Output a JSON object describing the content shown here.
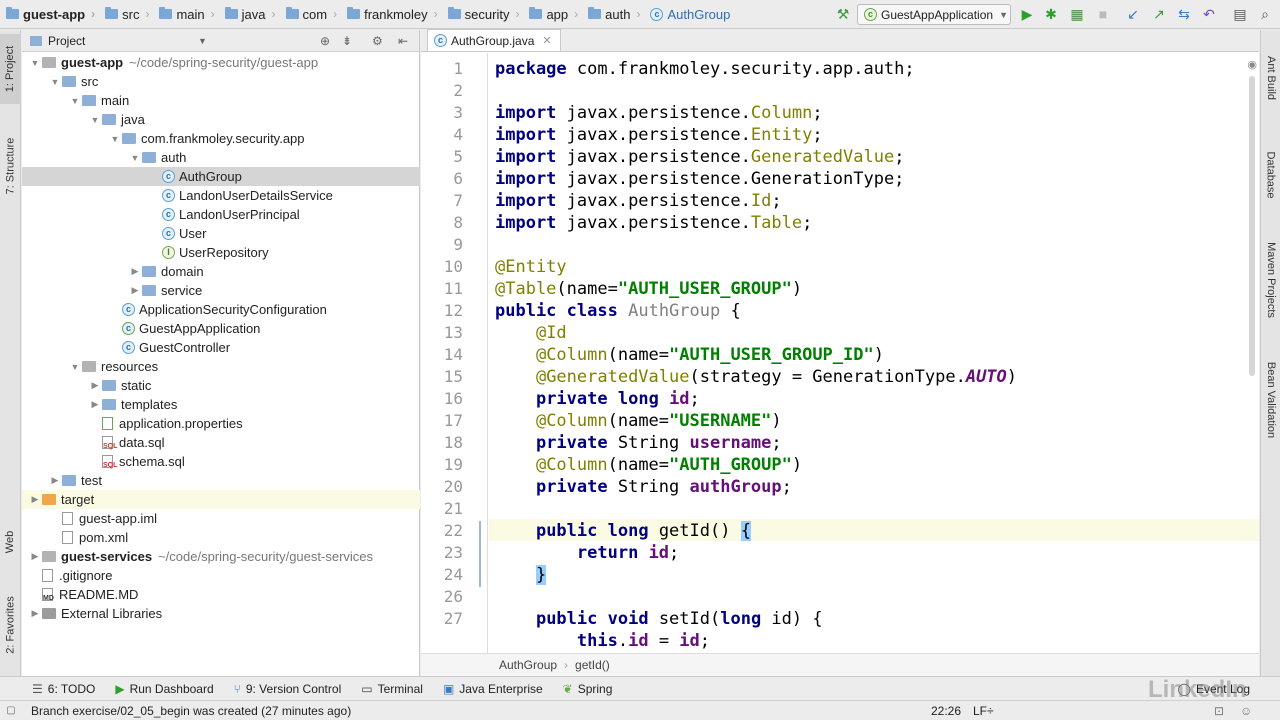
{
  "breadcrumbs": [
    "guest-app",
    "src",
    "main",
    "java",
    "com",
    "frankmoley",
    "security",
    "app",
    "auth",
    "AuthGroup"
  ],
  "run_config": "GuestAppApplication",
  "left_tabs": [
    "1: Project",
    "7: Structure",
    "Web",
    "2: Favorites"
  ],
  "right_tabs": [
    "Ant Build",
    "Database",
    "Maven Projects",
    "Bean Validation"
  ],
  "project": {
    "title": "Project",
    "rows": [
      {
        "label": "guest-app",
        "path": "~/code/spring-security/guest-app"
      },
      {
        "label": "src"
      },
      {
        "label": "main"
      },
      {
        "label": "java"
      },
      {
        "label": "com.frankmoley.security.app"
      },
      {
        "label": "auth"
      },
      {
        "label": "AuthGroup"
      },
      {
        "label": "LandonUserDetailsService"
      },
      {
        "label": "LandonUserPrincipal"
      },
      {
        "label": "User"
      },
      {
        "label": "UserRepository"
      },
      {
        "label": "domain"
      },
      {
        "label": "service"
      },
      {
        "label": "ApplicationSecurityConfiguration"
      },
      {
        "label": "GuestAppApplication"
      },
      {
        "label": "GuestController"
      },
      {
        "label": "resources"
      },
      {
        "label": "static"
      },
      {
        "label": "templates"
      },
      {
        "label": "application.properties"
      },
      {
        "label": "data.sql"
      },
      {
        "label": "schema.sql"
      },
      {
        "label": "test"
      },
      {
        "label": "target"
      },
      {
        "label": "guest-app.iml"
      },
      {
        "label": "pom.xml"
      },
      {
        "label": "guest-services",
        "path": "~/code/spring-security/guest-services"
      },
      {
        "label": ".gitignore"
      },
      {
        "label": "README.MD"
      },
      {
        "label": "External Libraries"
      }
    ]
  },
  "editor": {
    "tab": "AuthGroup.java",
    "line_numbers": [
      "1",
      "2",
      "3",
      "4",
      "5",
      "6",
      "7",
      "8",
      "9",
      "10",
      "11",
      "12",
      "13",
      "14",
      "15",
      "16",
      "17",
      "18",
      "19",
      "20",
      "21",
      "22",
      "23",
      "24",
      "26",
      "27"
    ],
    "code_lines": [
      "package com.frankmoley.security.app.auth;",
      "",
      "import javax.persistence.Column;",
      "import javax.persistence.Entity;",
      "import javax.persistence.GeneratedValue;",
      "import javax.persistence.GenerationType;",
      "import javax.persistence.Id;",
      "import javax.persistence.Table;",
      "",
      "@Entity",
      "@Table(name=\"AUTH_USER_GROUP\")",
      "public class AuthGroup {",
      "    @Id",
      "    @Column(name=\"AUTH_USER_GROUP_ID\")",
      "    @GeneratedValue(strategy = GenerationType.AUTO)",
      "    private long id;",
      "    @Column(name=\"USERNAME\")",
      "    private String username;",
      "    @Column(name=\"AUTH_GROUP\")",
      "    private String authGroup;",
      "",
      "    public long getId() {",
      "        return id;",
      "    }",
      "",
      "    public void setId(long id) {",
      "        this.id = id;"
    ],
    "footer_breadcrumb": [
      "AuthGroup",
      "getId()"
    ]
  },
  "bottom_tools": [
    "6: TODO",
    "Run Dashboard",
    "9: Version Control",
    "Terminal",
    "Java Enterprise",
    "Spring",
    "Event Log"
  ],
  "status": {
    "message": "Branch exercise/02_05_begin was created (27 minutes ago)",
    "position": "22:26",
    "line_sep": "LF÷"
  },
  "watermark": "LinkedIn"
}
